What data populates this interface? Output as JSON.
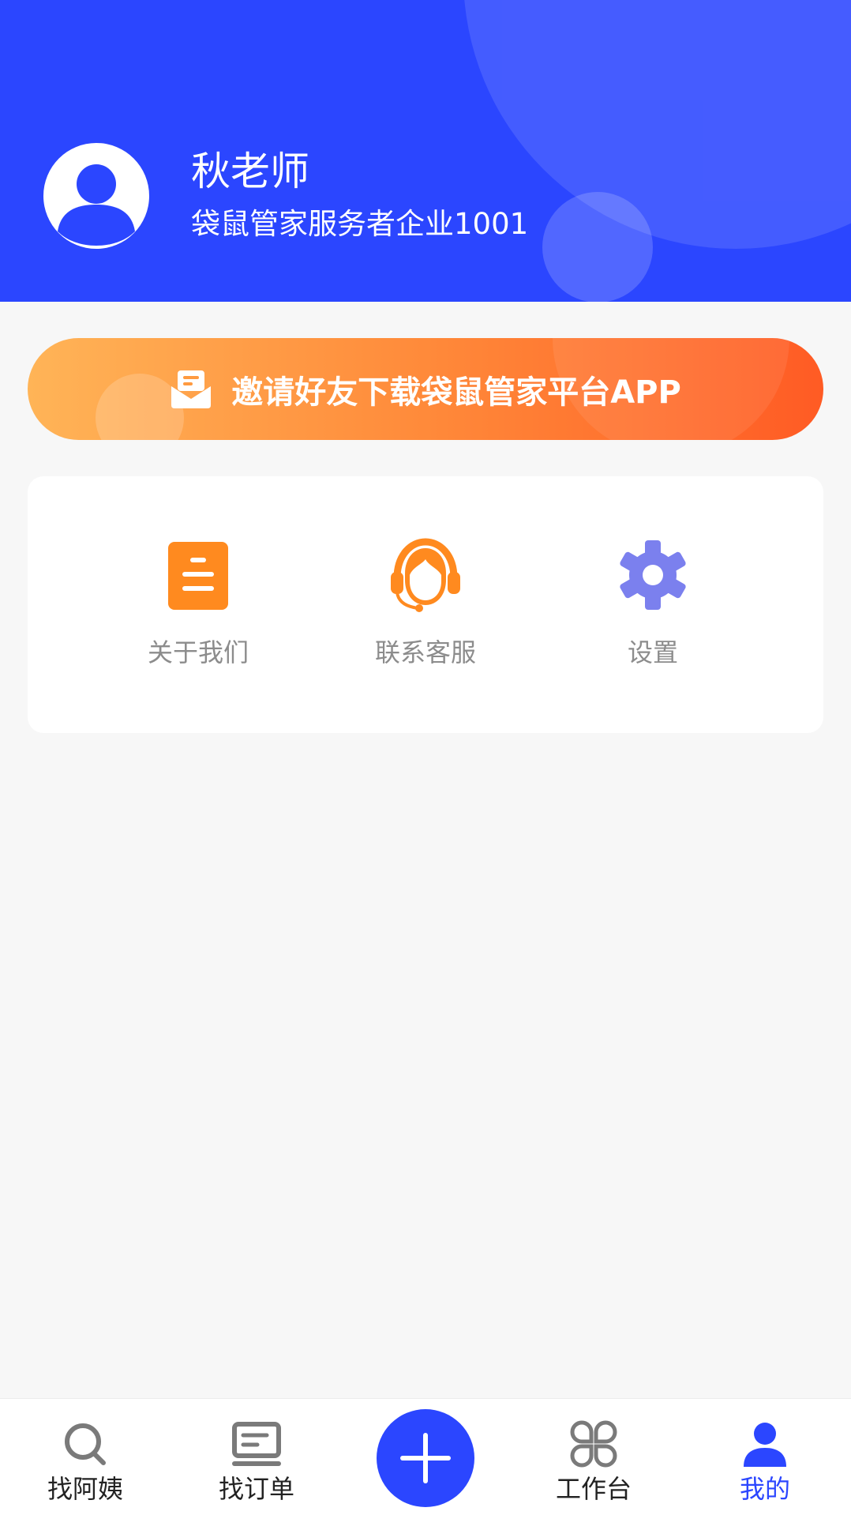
{
  "profile": {
    "name": "秋老师",
    "organization": "袋鼠管家服务者企业1001"
  },
  "invite": {
    "label": "邀请好友下载袋鼠管家平台APP"
  },
  "menu": {
    "items": [
      {
        "label": "关于我们",
        "icon": "document-icon"
      },
      {
        "label": "联系客服",
        "icon": "headset-icon"
      },
      {
        "label": "设置",
        "icon": "gear-icon"
      }
    ]
  },
  "tabbar": {
    "tabs": [
      {
        "label": "找阿姨",
        "icon": "search-icon"
      },
      {
        "label": "找订单",
        "icon": "order-list-icon"
      },
      {
        "label": "",
        "icon": "plus-icon"
      },
      {
        "label": "工作台",
        "icon": "workbench-icon"
      },
      {
        "label": "我的",
        "icon": "user-icon",
        "active": true
      }
    ]
  },
  "colors": {
    "brand": "#2b46ff",
    "banner_start": "#ffb457",
    "banner_end": "#ff5b24",
    "orange_icon": "#ff8a1f",
    "gear_icon": "#7b80ee",
    "menu_text": "#8c8c8c"
  }
}
